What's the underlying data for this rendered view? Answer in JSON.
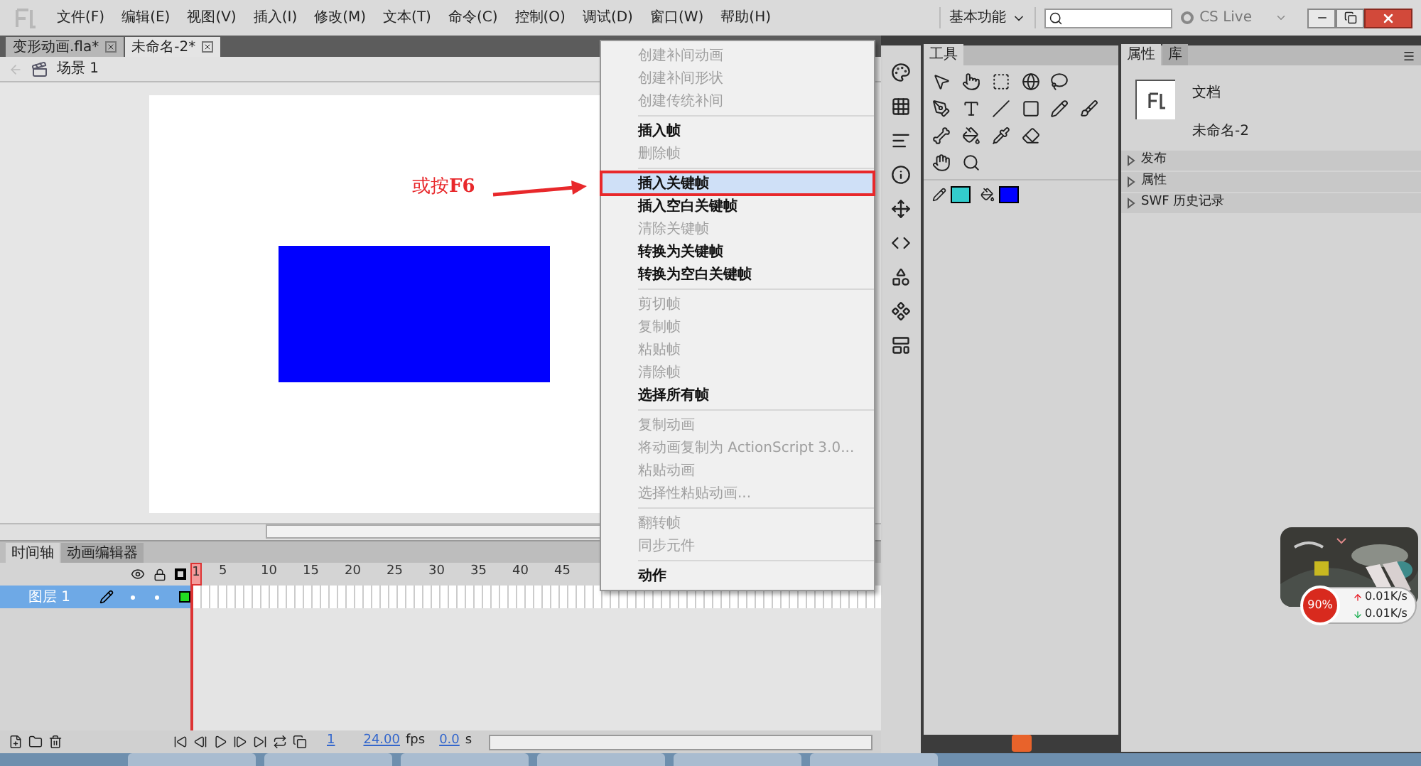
{
  "menu_bar": {
    "items": [
      "文件(F)",
      "编辑(E)",
      "视图(V)",
      "插入(I)",
      "修改(M)",
      "文本(T)",
      "命令(C)",
      "控制(O)",
      "调试(D)",
      "窗口(W)",
      "帮助(H)"
    ],
    "workspace": "基本功能",
    "cs_live": "CS Live"
  },
  "doc_tabs": [
    {
      "label": "变形动画.fla*",
      "selected": false
    },
    {
      "label": "未命名-2*",
      "selected": true
    }
  ],
  "scene": "场景 1",
  "annotation": {
    "text": "或按**F6**"
  },
  "context_menu": {
    "groups": [
      [
        {
          "label": "创建补间动画",
          "disabled": true,
          "selected": false,
          "outlined": false
        },
        {
          "label": "创建补间形状",
          "disabled": true,
          "selected": false,
          "outlined": false
        },
        {
          "label": "创建传统补间",
          "disabled": true,
          "selected": false,
          "outlined": false
        }
      ],
      [
        {
          "label": "插入帧",
          "disabled": false,
          "selected": false,
          "outlined": false
        },
        {
          "label": "删除帧",
          "disabled": true,
          "selected": false,
          "outlined": false
        }
      ],
      [
        {
          "label": "插入关键帧",
          "disabled": false,
          "selected": true,
          "outlined": true
        },
        {
          "label": "插入空白关键帧",
          "disabled": false,
          "selected": false,
          "outlined": false
        },
        {
          "label": "清除关键帧",
          "disabled": true,
          "selected": false,
          "outlined": false
        },
        {
          "label": "转换为关键帧",
          "disabled": false,
          "selected": false,
          "outlined": false
        },
        {
          "label": "转换为空白关键帧",
          "disabled": false,
          "selected": false,
          "outlined": false
        }
      ],
      [
        {
          "label": "剪切帧",
          "disabled": true,
          "selected": false,
          "outlined": false
        },
        {
          "label": "复制帧",
          "disabled": true,
          "selected": false,
          "outlined": false
        },
        {
          "label": "粘贴帧",
          "disabled": true,
          "selected": false,
          "outlined": false
        },
        {
          "label": "清除帧",
          "disabled": true,
          "selected": false,
          "outlined": false
        },
        {
          "label": "选择所有帧",
          "disabled": false,
          "selected": false,
          "outlined": false
        }
      ],
      [
        {
          "label": "复制动画",
          "disabled": true,
          "selected": false,
          "outlined": false
        },
        {
          "label": "将动画复制为 ActionScript 3.0...",
          "disabled": true,
          "selected": false,
          "outlined": false
        },
        {
          "label": "粘贴动画",
          "disabled": true,
          "selected": false,
          "outlined": false
        },
        {
          "label": "选择性粘贴动画...",
          "disabled": true,
          "selected": false,
          "outlined": false
        }
      ],
      [
        {
          "label": "翻转帧",
          "disabled": true,
          "selected": false,
          "outlined": false
        },
        {
          "label": "同步元件",
          "disabled": true,
          "selected": false,
          "outlined": false
        }
      ],
      [
        {
          "label": "动作",
          "disabled": false,
          "selected": false,
          "outlined": false
        }
      ]
    ]
  },
  "timeline": {
    "tabs": [
      {
        "label": "时间轴",
        "selected": true
      },
      {
        "label": "动画编辑器",
        "selected": false
      }
    ],
    "ticks": [
      "1",
      "5",
      "10",
      "15",
      "20",
      "25",
      "30",
      "35",
      "40",
      "45"
    ],
    "layers": [
      {
        "name": "图层 1",
        "selected": true
      }
    ],
    "controls": {
      "frame": "1",
      "fps": "24.00",
      "fps_unit": "fps",
      "time": "0.0",
      "time_unit": "s"
    }
  },
  "tools": {
    "title": "工具",
    "stroke": {
      "color": "#33cccc"
    },
    "fill": {
      "color": "#0000ff"
    }
  },
  "properties": {
    "tabs": [
      {
        "label": "属性",
        "selected": true
      },
      {
        "label": "库",
        "selected": false
      }
    ],
    "doc_kind": "文档",
    "doc_name": "未命名-2",
    "sections": [
      "发布",
      "属性",
      "SWF 历史记录"
    ]
  },
  "net_widget": {
    "percent": "90%",
    "up": "0.01K/s",
    "down": "0.01K/s"
  }
}
